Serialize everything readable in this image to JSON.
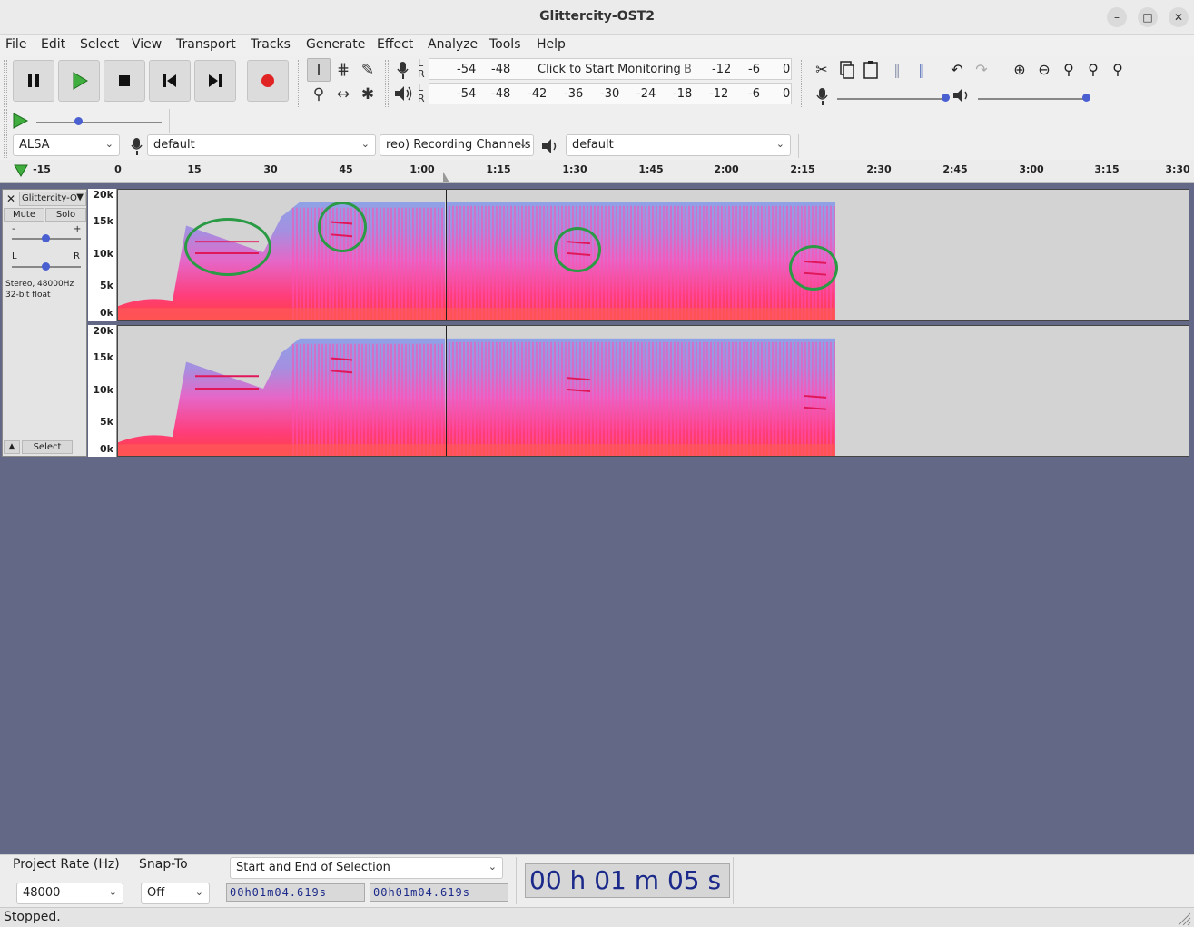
{
  "window": {
    "title": "Glittercity-OST2"
  },
  "menu": [
    "File",
    "Edit",
    "Select",
    "View",
    "Transport",
    "Tracks",
    "Generate",
    "Effect",
    "Analyze",
    "Tools",
    "Help"
  ],
  "meters": {
    "record": [
      "-54",
      "-48"
    ],
    "record_prompt": "Click to Start Monitoring",
    "record_trail": [
      "-12",
      "-6",
      "0"
    ],
    "playback": [
      "-54",
      "-48",
      "-42",
      "-36",
      "-30",
      "-24",
      "-18",
      "-12",
      "-6",
      "0"
    ],
    "lr_top": "L",
    "lr_bottom": "R"
  },
  "device": {
    "host": "ALSA",
    "recording_device": "default",
    "recording_channels": "reo) Recording Channels",
    "playback_device": "default"
  },
  "ruler": [
    "-15",
    "0",
    "15",
    "30",
    "45",
    "1:00",
    "1:15",
    "1:30",
    "1:45",
    "2:00",
    "2:15",
    "2:30",
    "2:45",
    "3:00",
    "3:15",
    "3:30"
  ],
  "track": {
    "name": "Glittercity-O",
    "mute": "Mute",
    "solo": "Solo",
    "gain_minus": "-",
    "gain_plus": "+",
    "pan_left": "L",
    "pan_right": "R",
    "format_line1": "Stereo, 48000Hz",
    "format_line2": "32-bit float",
    "select": "Select",
    "freq_labels": [
      "20k",
      "15k",
      "10k",
      "5k",
      "0k"
    ]
  },
  "selection": {
    "project_rate_label": "Project Rate (Hz)",
    "project_rate": "48000",
    "snap_label": "Snap-To",
    "snap_value": "Off",
    "mode": "Start and End of Selection",
    "start": "00h01m04.619s",
    "end": "00h01m04.619s"
  },
  "audio_position": {
    "h": "00",
    "h_unit": "h",
    "m": "01",
    "m_unit": "m",
    "s": "05",
    "s_unit": "s"
  },
  "status": "Stopped.",
  "colors": {
    "workspace": "#636887",
    "time_digits": "#1b2a8a",
    "annotation": "#2a9a45"
  }
}
